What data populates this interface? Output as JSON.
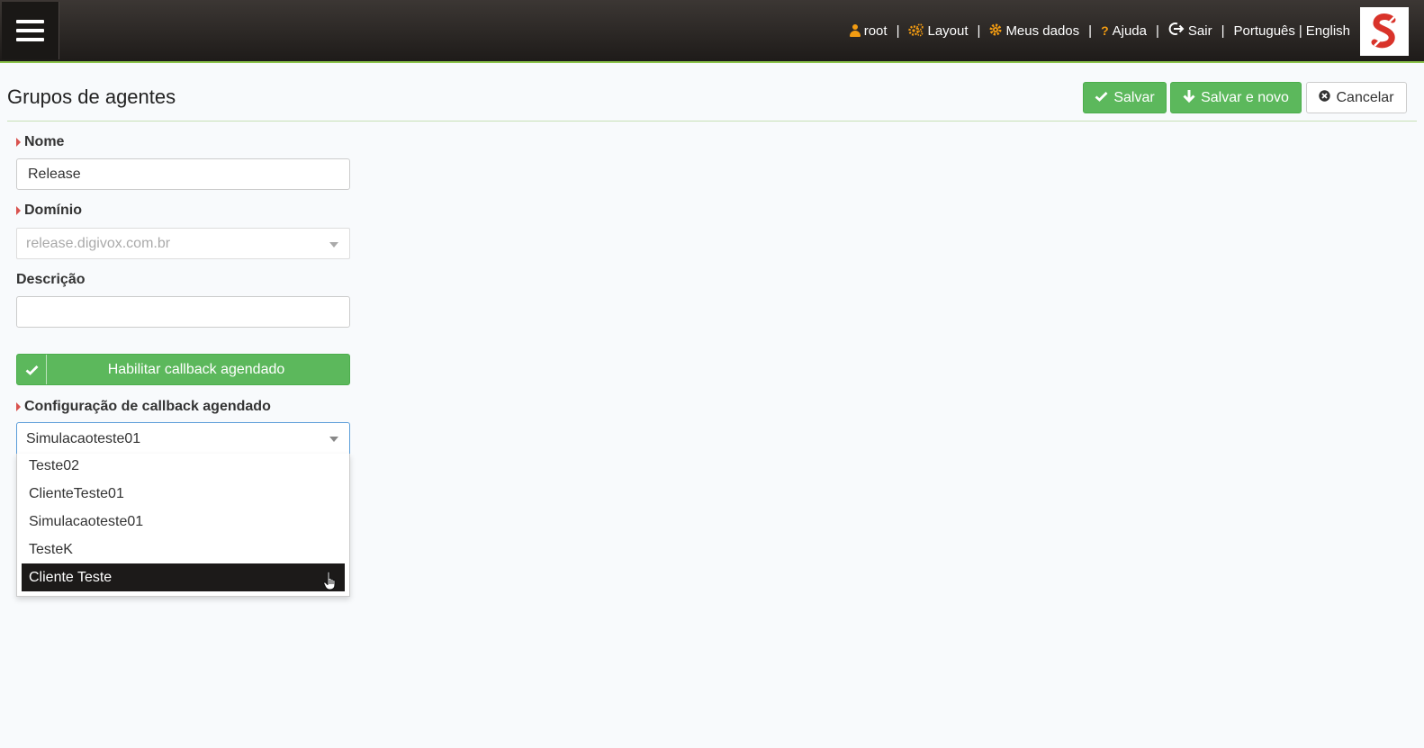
{
  "topbar": {
    "nav": {
      "user": "root",
      "layout": "Layout",
      "my_data": "Meus dados",
      "help": "Ajuda",
      "logout": "Sair",
      "lang_pt": "Português",
      "lang_sep": "|",
      "lang_en": "English"
    },
    "separator": "|",
    "icons": [
      "menu-icon",
      "user-icon",
      "cogs-icon",
      "gear-icon",
      "question-icon",
      "sign-out-icon",
      "logo-icon"
    ]
  },
  "page": {
    "title": "Grupos de agentes"
  },
  "actions": {
    "save": "Salvar",
    "save_new": "Salvar e novo",
    "cancel": "Cancelar"
  },
  "form": {
    "name": {
      "label": "Nome",
      "value": "Release"
    },
    "domain": {
      "label": "Domínio",
      "value": "release.digivox.com.br"
    },
    "description": {
      "label": "Descrição",
      "value": ""
    },
    "callback_toggle": {
      "label": "Habilitar callback agendado",
      "enabled": true
    },
    "callback_config": {
      "label": "Configuração de callback agendado",
      "selected": "Simulacaoteste01",
      "options": [
        "Teste02",
        "ClienteTeste01",
        "Simulacaoteste01",
        "TesteK",
        "Cliente Teste"
      ],
      "highlighted": "Cliente Teste"
    }
  },
  "colors": {
    "accent_green": "#5cb85c",
    "required_marker": "#d9534f",
    "nav_icon_orange": "#f39c12",
    "logo_red": "#d9332a",
    "highlight_dark": "#1c1a19"
  }
}
